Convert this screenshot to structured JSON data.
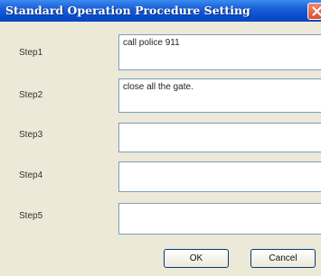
{
  "dialog": {
    "title": "Standard Operation Procedure Setting",
    "close_icon": "close-x-icon"
  },
  "steps": [
    {
      "label": "Step1",
      "value": "call police 911"
    },
    {
      "label": "Step2",
      "value": "close all the gate."
    },
    {
      "label": "Step3",
      "value": ""
    },
    {
      "label": "Step4",
      "value": ""
    },
    {
      "label": "Step5",
      "value": ""
    }
  ],
  "buttons": {
    "ok_label": "OK",
    "cancel_label": "Cancel"
  },
  "colors": {
    "titlebar": "#0a4fd0",
    "dialog_bg": "#ECE9D8",
    "field_border": "#7f9db9",
    "close_button": "#d8512e"
  }
}
